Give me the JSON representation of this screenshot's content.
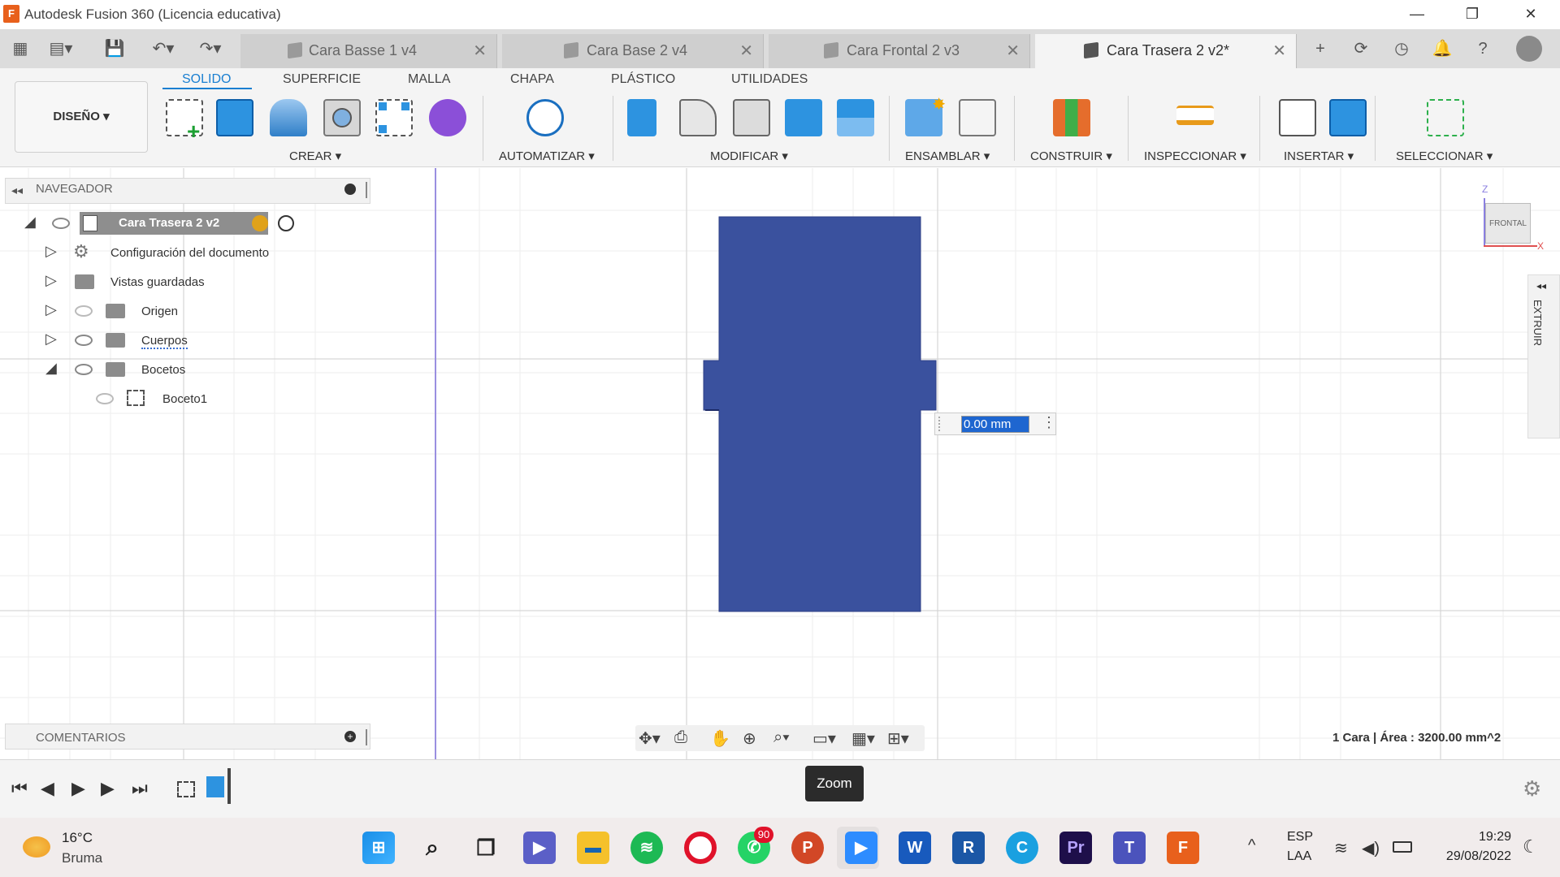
{
  "window": {
    "title": "Autodesk Fusion 360 (Licencia educativa)",
    "logo": "F"
  },
  "doc_tabs": [
    {
      "label": "Cara Basse 1 v4",
      "close": "✕"
    },
    {
      "label": "Cara Base 2 v4",
      "close": "✕"
    },
    {
      "label": "Cara Frontal 2 v3",
      "close": "✕"
    },
    {
      "label": "Cara Trasera 2 v2*",
      "close": "✕",
      "active": true
    }
  ],
  "ribbon_tabs": [
    "SOLIDO",
    "SUPERFICIE",
    "MALLA",
    "CHAPA",
    "PLÁSTICO",
    "UTILIDADES"
  ],
  "workspace": "DISEÑO ▾",
  "groups": [
    "CREAR ▾",
    "AUTOMATIZAR ▾",
    "MODIFICAR ▾",
    "ENSAMBLAR ▾",
    "CONSTRUIR ▾",
    "INSPECCIONAR ▾",
    "INSERTAR ▾",
    "SELECCIONAR ▾"
  ],
  "navigator": {
    "title": "NAVEGADOR",
    "root": "Cara Trasera 2 v2",
    "items": [
      {
        "label": "Configuración del documento"
      },
      {
        "label": "Vistas guardadas"
      },
      {
        "label": "Origen"
      },
      {
        "label": "Cuerpos"
      },
      {
        "label": "Bocetos"
      },
      {
        "label": "Boceto1"
      }
    ]
  },
  "comments": {
    "title": "COMENTARIOS"
  },
  "viewcube": {
    "face": "FRONTAL",
    "z": "Z",
    "x": "X"
  },
  "side_panel": {
    "label": "EXTRUIR"
  },
  "dimension_input": {
    "value": "0.00 mm"
  },
  "status": {
    "selection": "1 Cara | Área : 3200.00 mm^2"
  },
  "tooltip": {
    "text": "Zoom"
  },
  "colors": {
    "accent": "#1a7fd1",
    "body": "#3a519e",
    "fusion": "#e8601c"
  },
  "taskbar": {
    "weather_temp": "16°C",
    "weather_desc": "Bruma",
    "whatsapp_badge": "90",
    "lang": "ESP",
    "layout": "LAA",
    "time": "19:29",
    "date": "29/08/2022",
    "apps": [
      "W",
      "R",
      "C",
      "Pr",
      "F"
    ]
  }
}
